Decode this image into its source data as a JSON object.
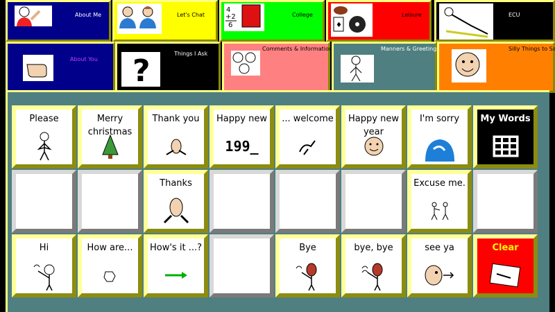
{
  "top_tabs": [
    {
      "label": "About Me",
      "icon": "person-waving-icon",
      "bg": "#00008b",
      "fg": "#ffffff"
    },
    {
      "label": "Let's Chat",
      "icon": "two-people-talking-icon",
      "bg": "#ffff00",
      "fg": "#000000"
    },
    {
      "label": "College",
      "icon": "math-book-icon",
      "bg": "#00ff00",
      "fg": "#000000"
    },
    {
      "label": "Leisure",
      "icon": "leisure-items-icon",
      "bg": "#ff0000",
      "fg": "#000000"
    },
    {
      "label": "ECU",
      "icon": "relaxing-person-icon",
      "bg": "#000000",
      "fg": "#ffffff"
    }
  ],
  "sub_tabs": [
    {
      "label": "About You",
      "icon": "pointing-hand-icon",
      "bg": "#00008b",
      "fg": "#c040ff"
    },
    {
      "label": "Things I Ask",
      "icon": "question-mark-icon",
      "bg": "#000000",
      "fg": "#ffffff"
    },
    {
      "label": "Comments & Information",
      "icon": "faces-icon",
      "bg": "#ff8080",
      "fg": "#000000"
    },
    {
      "label": "Manners & Greetings",
      "icon": "polite-person-icon",
      "bg": "#4f7f80",
      "fg": "#ffffff"
    },
    {
      "label": "Silly Things to Say",
      "icon": "silly-face-icon",
      "bg": "#ff8000",
      "fg": "#000000"
    }
  ],
  "grid": {
    "rows": [
      [
        {
          "label": "Please",
          "icon": "please-gesture-icon",
          "style": "normal"
        },
        {
          "label": "Merry christmas",
          "icon": "christmas-tree-icon",
          "style": "normal"
        },
        {
          "label": "Thank you",
          "icon": "thank-you-gesture-icon",
          "style": "normal"
        },
        {
          "label": "Happy new",
          "icon_text": "199_",
          "icon": "year-text-icon",
          "style": "normal"
        },
        {
          "label": "... welcome",
          "icon": "welcome-gesture-icon",
          "style": "normal"
        },
        {
          "label": "Happy new year",
          "icon": "smiling-face-icon",
          "style": "normal"
        },
        {
          "label": "I'm sorry",
          "icon": "sorry-gesture-icon",
          "style": "normal"
        },
        {
          "label": "My Words",
          "icon": "word-grid-icon",
          "style": "mine"
        }
      ],
      [
        {
          "label": "",
          "style": "empty"
        },
        {
          "label": "",
          "style": "empty"
        },
        {
          "label": "Thanks",
          "icon": "thanks-gesture-icon",
          "style": "normal"
        },
        {
          "label": "",
          "style": "empty"
        },
        {
          "label": "",
          "style": "empty"
        },
        {
          "label": "",
          "style": "empty"
        },
        {
          "label": "Excuse me.",
          "icon": "excuse-me-people-icon",
          "style": "normal"
        },
        {
          "label": "",
          "style": "empty"
        }
      ],
      [
        {
          "label": "Hi",
          "icon": "hi-wave-icon",
          "style": "normal"
        },
        {
          "label": "How are...",
          "icon": "how-are-hand-icon",
          "style": "normal"
        },
        {
          "label": "How's it ...?",
          "icon": "green-arrow-icon",
          "style": "normal"
        },
        {
          "label": "",
          "style": "empty"
        },
        {
          "label": "Bye",
          "icon": "bye-wave-icon",
          "style": "normal"
        },
        {
          "label": "bye, bye",
          "icon": "bye-bye-wave-icon",
          "style": "normal"
        },
        {
          "label": "see ya",
          "icon": "see-ya-face-icon",
          "style": "normal"
        },
        {
          "label": "Clear",
          "icon": "eraser-icon",
          "style": "clear"
        }
      ]
    ]
  }
}
